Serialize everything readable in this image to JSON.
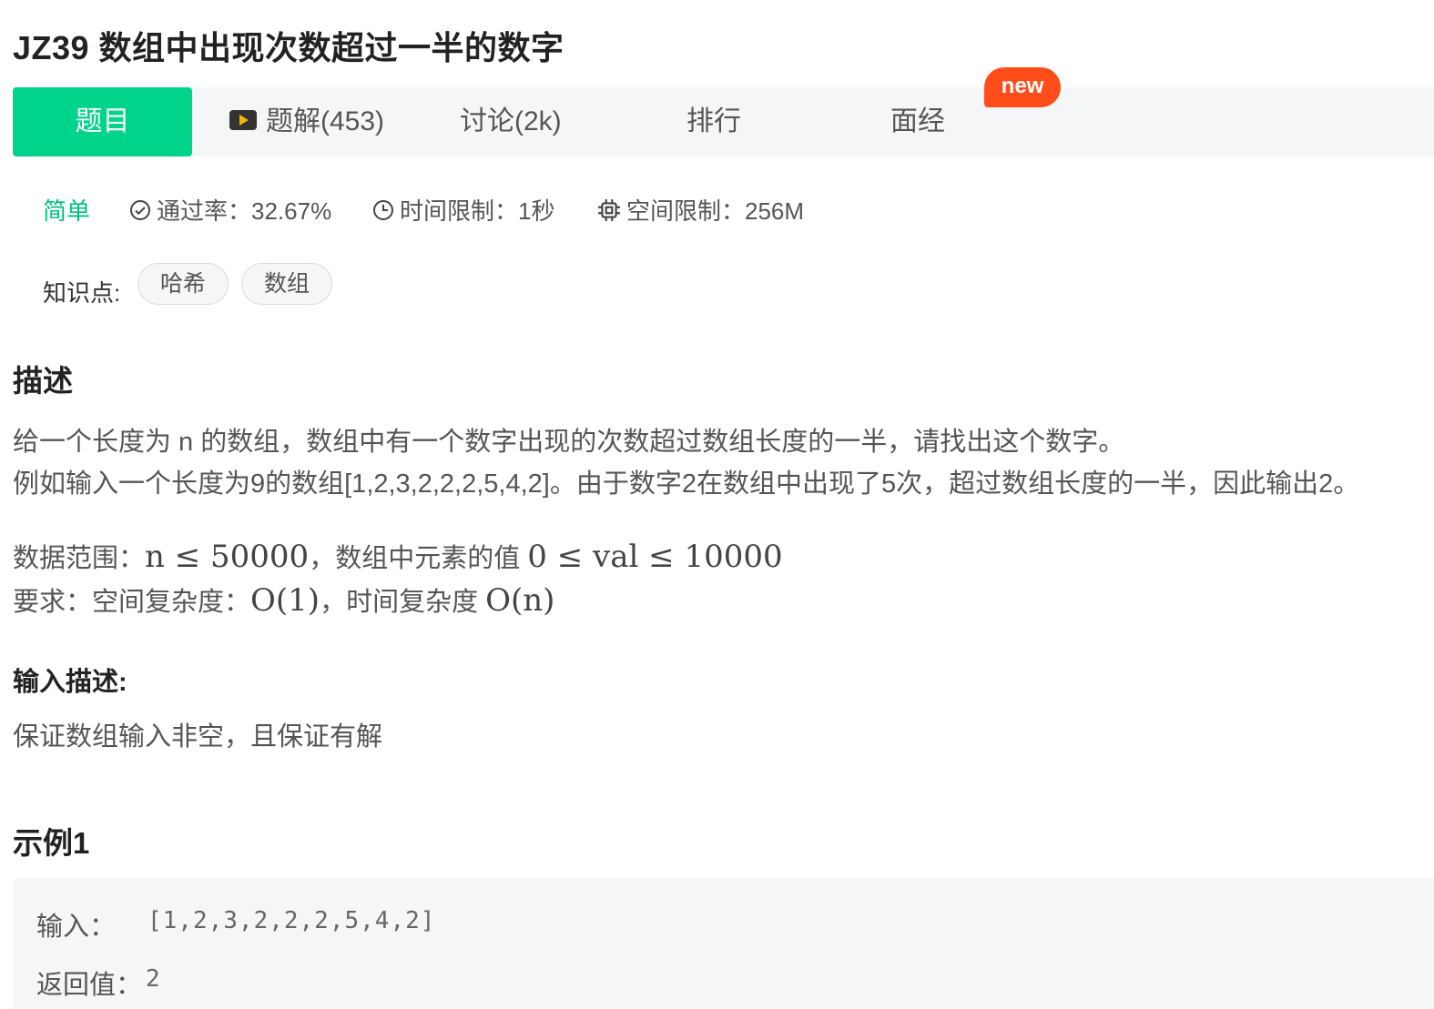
{
  "problem": {
    "title": "JZ39  数组中出现次数超过一半的数字"
  },
  "tabs": [
    {
      "label": "题目"
    },
    {
      "label": "题解(453)"
    },
    {
      "label": "讨论(2k)"
    },
    {
      "label": "排行"
    },
    {
      "label": "面经"
    }
  ],
  "new_badge": "new",
  "meta": {
    "difficulty": "简单",
    "pass_rate": "通过率：32.67%",
    "time_limit": "时间限制：1秒",
    "space_limit": "空间限制：256M"
  },
  "knowledge": {
    "label": "知识点:",
    "tags": [
      "哈希",
      "数组"
    ]
  },
  "description": {
    "heading": "描述",
    "line1": "给一个长度为 n 的数组，数组中有一个数字出现的次数超过数组长度的一半，请找出这个数字。",
    "line2": "例如输入一个长度为9的数组[1,2,3,2,2,2,5,4,2]。由于数字2在数组中出现了5次，超过数组长度的一半，因此输出2。",
    "range_label": "数据范围：",
    "range_math_1": "n ≤ 50000",
    "range_sep": "，数组中元素的值 ",
    "range_math_2": "0 ≤ val ≤ 10000",
    "req_label": "要求：空间复杂度：",
    "req_math_1": "O(1)",
    "req_sep": "，时间复杂度 ",
    "req_math_2": "O(n)"
  },
  "input_desc": {
    "heading": "输入描述:",
    "text": "保证数组输入非空，且保证有解"
  },
  "example": {
    "heading": "示例1",
    "input_label": "输入：",
    "input_value": "[1,2,3,2,2,2,5,4,2]",
    "output_label": "返回值：",
    "output_value": "2"
  },
  "colors": {
    "accent": "#00d48b",
    "badge": "#ff4d1a",
    "tab_bg": "#f5f6f8"
  }
}
